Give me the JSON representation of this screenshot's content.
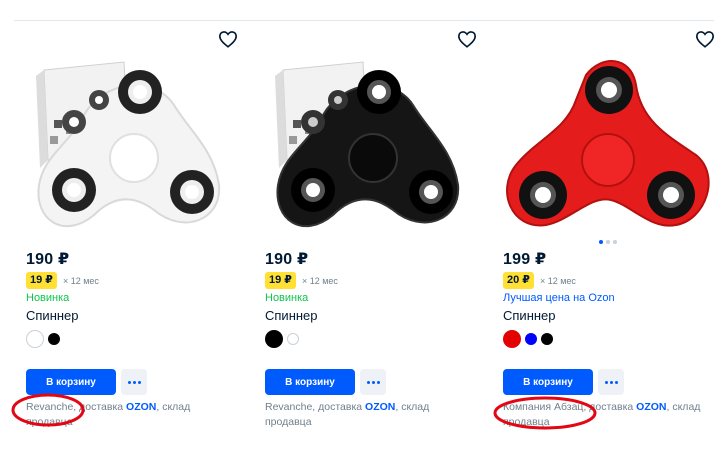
{
  "accent_color": "#005bff",
  "badge_color": "#ffe033",
  "annotation_color": "#e30613",
  "products": [
    {
      "price": "190 ₽",
      "installment_badge": "19 ₽",
      "installment_term": "× 12 мес",
      "tag": "Новинка",
      "tag_color": "#10c44c",
      "title": "Спиннер",
      "colors": [
        "#ffffff",
        "#000000"
      ],
      "spinner_color": "white",
      "add_to_cart": "В корзину",
      "seller_name": "Revanche",
      "delivery_prefix": ", доставка ",
      "delivery_brand": "OZON",
      "delivery_suffix": ", склад продавца",
      "favorite_icon": "heart-outline-icon",
      "more_icon": "ellipsis-icon",
      "circled": true
    },
    {
      "price": "190 ₽",
      "installment_badge": "19 ₽",
      "installment_term": "× 12 мес",
      "tag": "Новинка",
      "tag_color": "#10c44c",
      "title": "Спиннер",
      "colors": [
        "#000000",
        "#ffffff"
      ],
      "spinner_color": "black",
      "add_to_cart": "В корзину",
      "seller_name": "Revanche",
      "delivery_prefix": ", доставка ",
      "delivery_brand": "OZON",
      "delivery_suffix": ", склад продавца",
      "favorite_icon": "heart-outline-icon",
      "more_icon": "ellipsis-icon",
      "circled": false
    },
    {
      "price": "199 ₽",
      "installment_badge": "20 ₽",
      "installment_term": "× 12 мес",
      "tag": "Лучшая цена на Ozon",
      "tag_color": "#005bff",
      "title": "Спиннер",
      "colors": [
        "#e30000",
        "#0000ff",
        "#000000"
      ],
      "spinner_color": "red",
      "add_to_cart": "В корзину",
      "seller_name": "Компания Абзац",
      "delivery_prefix": ", доставка ",
      "delivery_brand": "OZON",
      "delivery_suffix": ", склад продавца",
      "favorite_icon": "heart-outline-icon",
      "more_icon": "ellipsis-icon",
      "circled": true,
      "gallery_dots": 3,
      "gallery_active": 1
    }
  ]
}
